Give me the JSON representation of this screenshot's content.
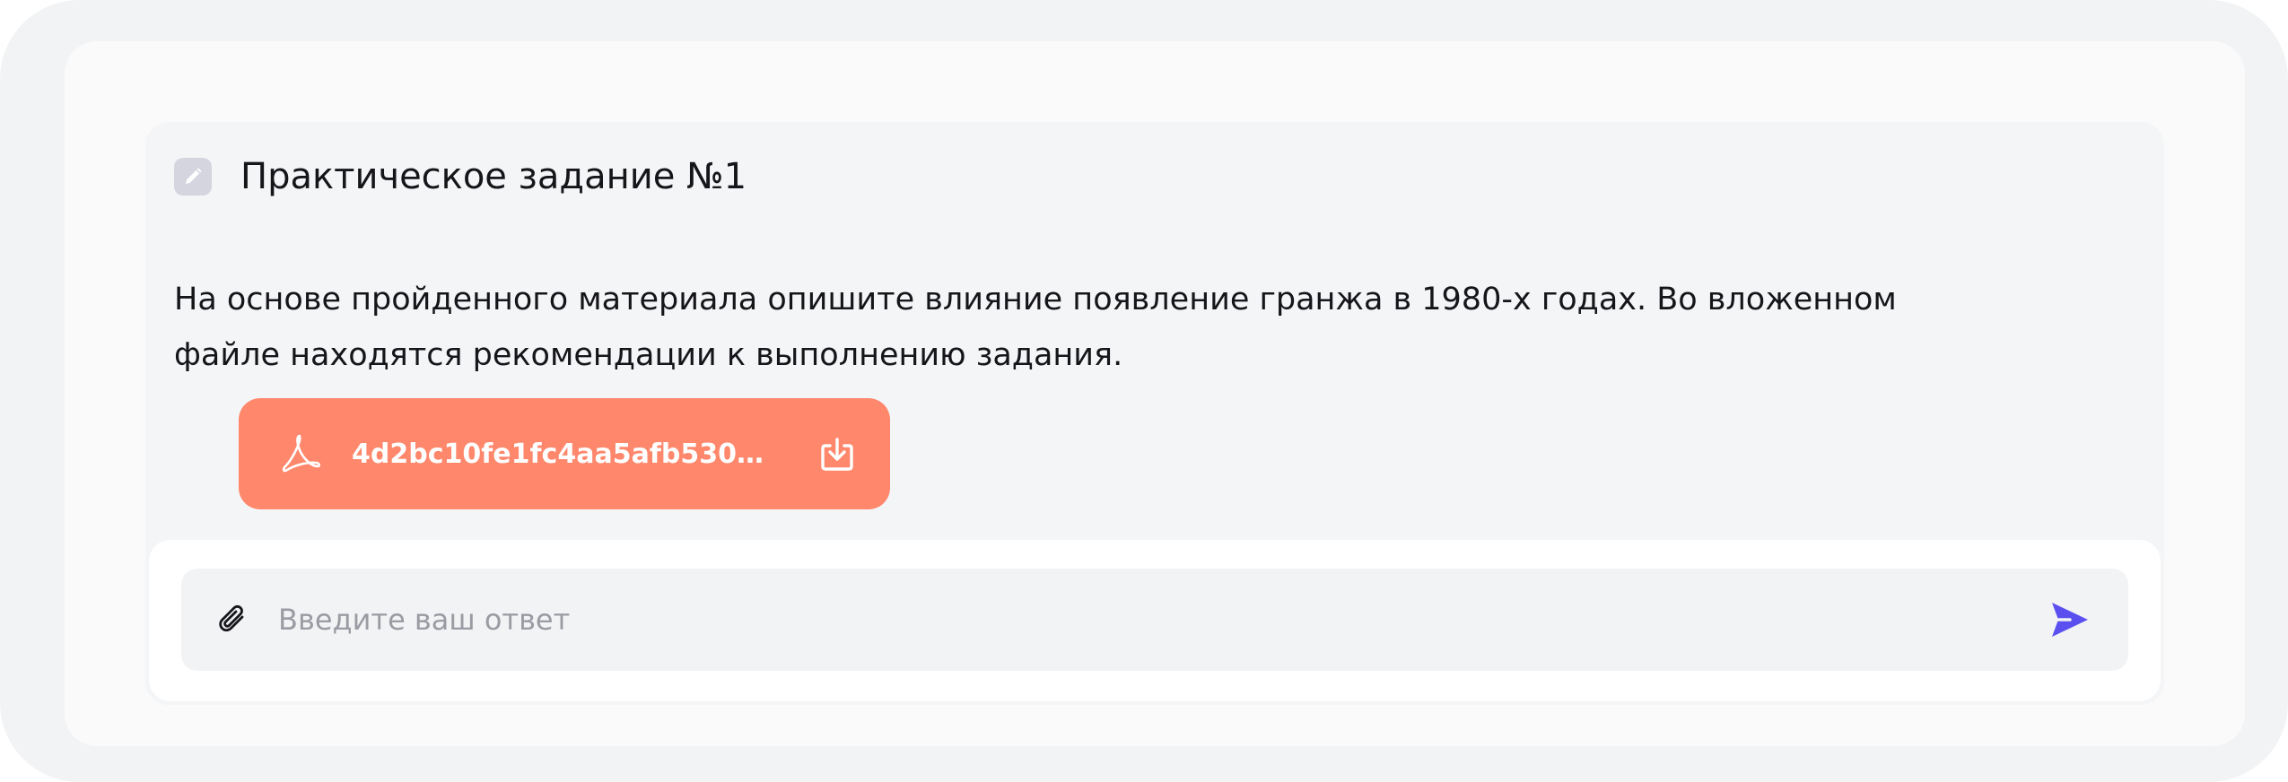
{
  "task": {
    "title": "Практическое задание №1",
    "description": "На основе пройденного материала опишите влияние появление гранжа в 1980-х годах. Во вложенном файле находятся рекомендации к выполнению задания."
  },
  "attachment": {
    "file_name": "4d2bc10fe1fc4aa5afb530...",
    "icon": "pdf-icon",
    "download_icon": "download-icon",
    "color": "#fe876c"
  },
  "answer": {
    "placeholder": "Введите ваш ответ",
    "value": "",
    "attach_icon": "paperclip-icon",
    "send_icon": "send-icon",
    "send_color": "#5b4ff0"
  }
}
